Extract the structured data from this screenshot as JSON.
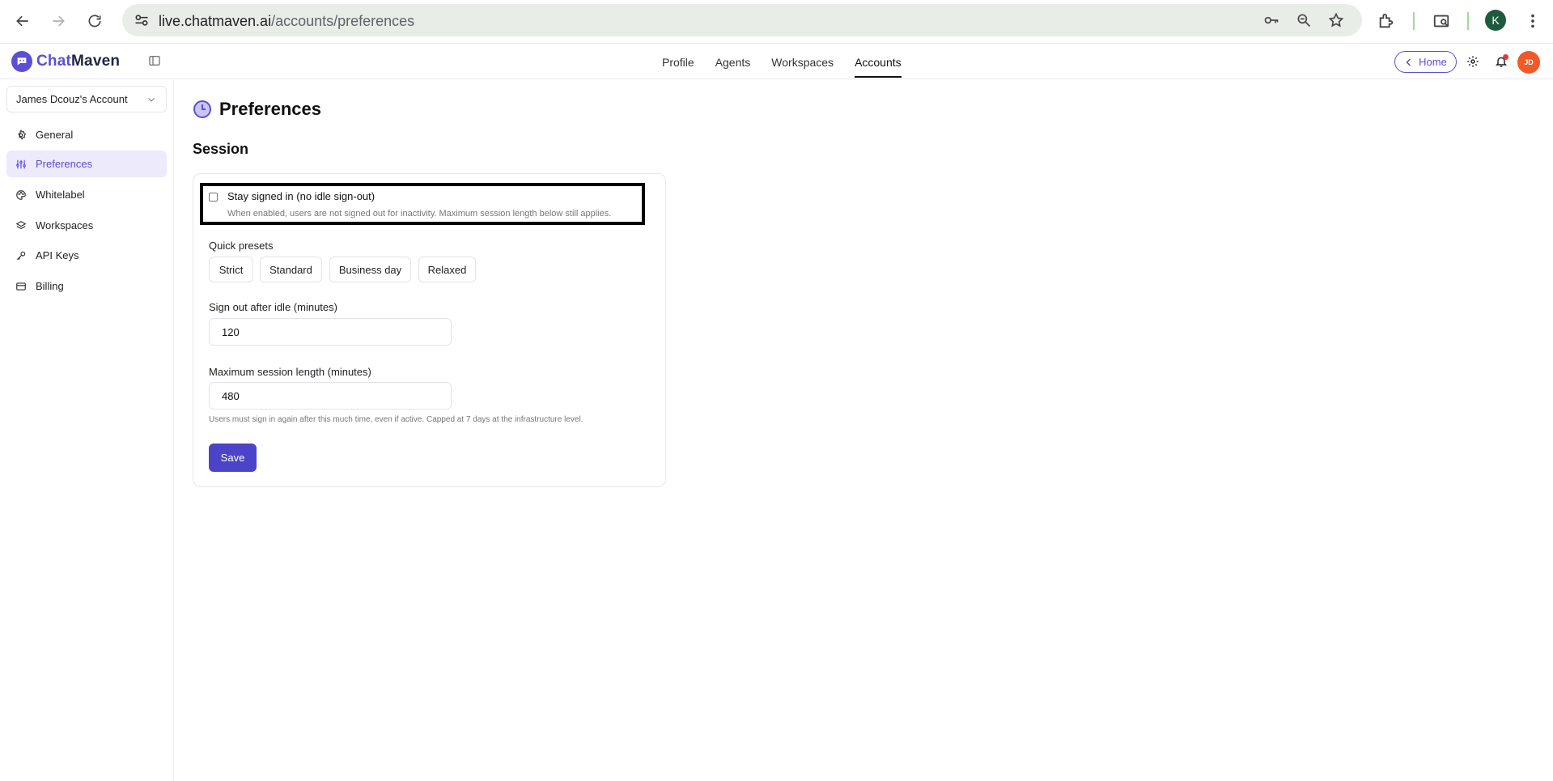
{
  "browser": {
    "url_host": "live.chatmaven.ai",
    "url_path": "/accounts/preferences",
    "profile_initial": "K"
  },
  "app": {
    "brand_prefix": "Chat",
    "brand_suffix": "Maven",
    "brand_color": "#5b4fd6",
    "nav_tabs": [
      {
        "label": "Profile",
        "active": false
      },
      {
        "label": "Agents",
        "active": false
      },
      {
        "label": "Workspaces",
        "active": false
      },
      {
        "label": "Accounts",
        "active": true
      }
    ],
    "home_label": "Home",
    "avatar_initials": "JD"
  },
  "sidebar": {
    "account_name": "James Dcouz's Account",
    "items": [
      {
        "label": "General",
        "icon": "gear-icon",
        "active": false
      },
      {
        "label": "Preferences",
        "icon": "sliders-icon",
        "active": true
      },
      {
        "label": "Whitelabel",
        "icon": "palette-icon",
        "active": false
      },
      {
        "label": "Workspaces",
        "icon": "layers-icon",
        "active": false
      },
      {
        "label": "API Keys",
        "icon": "key-icon",
        "active": false
      },
      {
        "label": "Billing",
        "icon": "credit-card-icon",
        "active": false
      }
    ]
  },
  "main": {
    "title": "Preferences",
    "section_title": "Session",
    "stay_signed_in": {
      "label": "Stay signed in (no idle sign-out)",
      "help": "When enabled, users are not signed out for inactivity. Maximum session length below still applies.",
      "checked": false
    },
    "presets_label": "Quick presets",
    "presets": [
      "Strict",
      "Standard",
      "Business day",
      "Relaxed"
    ],
    "idle_label": "Sign out after idle (minutes)",
    "idle_value": "120",
    "max_label": "Maximum session length (minutes)",
    "max_value": "480",
    "max_help": "Users must sign in again after this much time, even if active. Capped at 7 days at the infrastructure level.",
    "save_label": "Save"
  }
}
